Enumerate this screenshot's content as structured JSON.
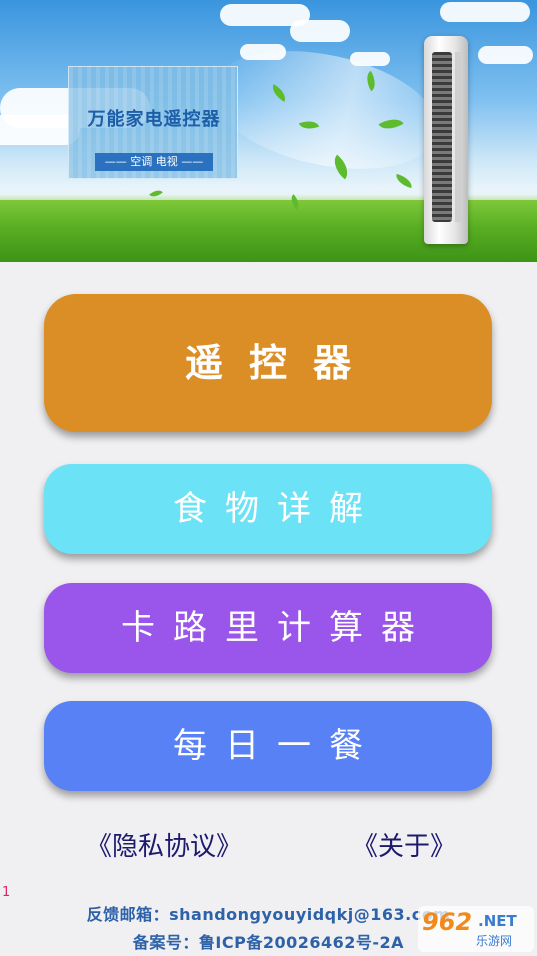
{
  "banner": {
    "app_name": "万能家电遥控器",
    "subtitle": "—— 空调  电视 ——"
  },
  "menu": {
    "remote_label": "遥控器",
    "food_label": "食物详解",
    "calorie_label": "卡路里计算器",
    "meal_label": "每日一餐"
  },
  "links": {
    "privacy": "《隐私协议》",
    "about": "《关于》"
  },
  "marker": "1",
  "footer": {
    "email": "反馈邮箱：shandongyouyidqkj@163.com",
    "icp": "备案号：鲁ICP备20026462号-2A"
  },
  "watermark": {
    "logo": "962",
    "net": ".NET",
    "sub": "乐游网"
  },
  "colors": {
    "remote": "#dc8e26",
    "food": "#6ce2f6",
    "calorie": "#9a55ea",
    "meal": "#5781f5"
  }
}
